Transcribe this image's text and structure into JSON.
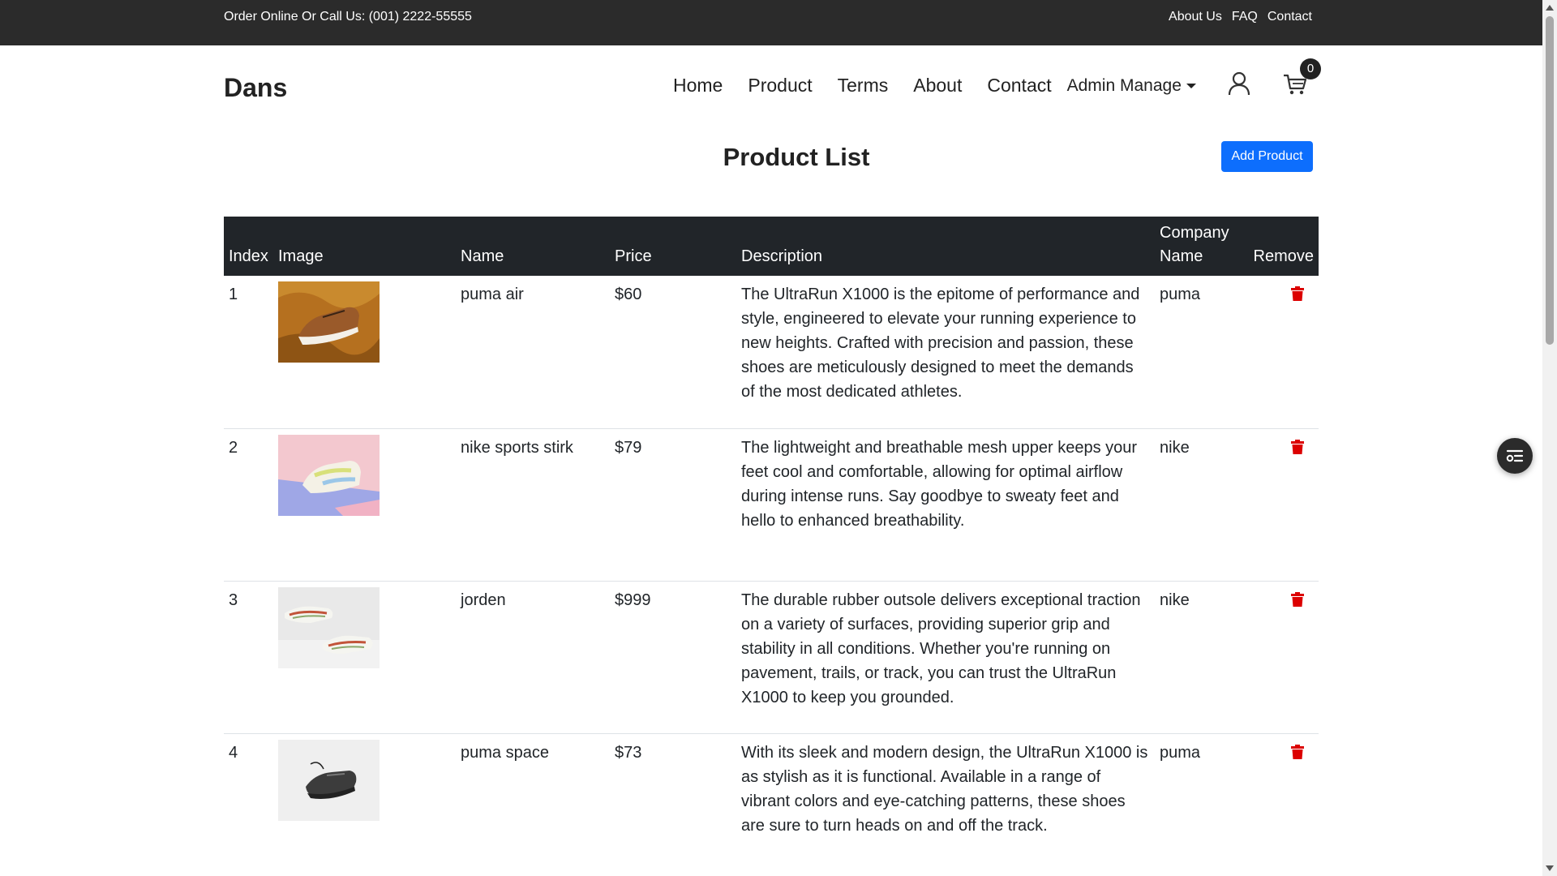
{
  "topbar": {
    "promo": "Order Online Or Call Us: (001) 2222-55555",
    "links": [
      "About Us",
      "FAQ",
      "Contact"
    ]
  },
  "header": {
    "brand": "Dans",
    "nav": [
      "Home",
      "Product",
      "Terms",
      "About",
      "Contact"
    ],
    "admin_dropdown": "Admin Manage",
    "cart_count": "0",
    "icons": [
      "user-icon",
      "cart-icon"
    ]
  },
  "main": {
    "title": "Product List",
    "add_button": "Add Product",
    "table": {
      "headers": {
        "index": "Index",
        "image": "Image",
        "name": "Name",
        "price": "Price",
        "description": "Description",
        "company": "Company Name",
        "remove": "Remove"
      },
      "rows": [
        {
          "index": "1",
          "name": "puma air",
          "price": "$60",
          "description": "The UltraRun X1000 is the epitome of performance and style, engineered to elevate your running experience to new heights. Crafted with precision and passion, these shoes are meticulously designed to meet the demands of the most dedicated athletes.",
          "company": "puma"
        },
        {
          "index": "2",
          "name": "nike sports stirk",
          "price": "$79",
          "description": "The lightweight and breathable mesh upper keeps your feet cool and comfortable, allowing for optimal airflow during intense runs. Say goodbye to sweaty feet and hello to enhanced breathability.",
          "company": "nike"
        },
        {
          "index": "3",
          "name": "jorden",
          "price": "$999",
          "description": "The durable rubber outsole delivers exceptional traction on a variety of surfaces, providing superior grip and stability in all conditions. Whether you're running on pavement, trails, or track, you can trust the UltraRun X1000 to keep you grounded.",
          "company": "nike"
        },
        {
          "index": "4",
          "name": "puma space",
          "price": "$73",
          "description": "With its sleek and modern design, the UltraRun X1000 is as stylish as it is functional. Available in a range of vibrant colors and eye-catching patterns, these shoes are sure to turn heads on and off the track.",
          "company": "puma"
        }
      ]
    }
  },
  "colors": {
    "topbar_bg": "#2b2b2b",
    "table_header_bg": "#212529",
    "primary": "#0d6efd",
    "danger": "#dc0000"
  }
}
